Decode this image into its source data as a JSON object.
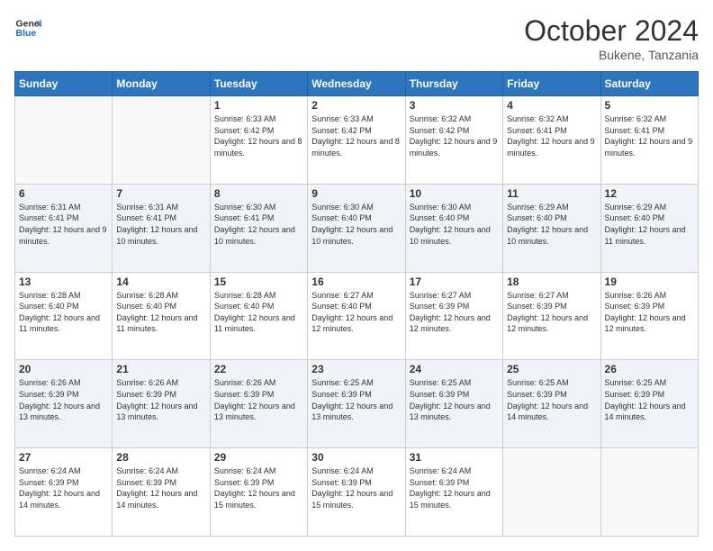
{
  "header": {
    "logo_line1": "General",
    "logo_line2": "Blue",
    "month": "October 2024",
    "location": "Bukene, Tanzania"
  },
  "days_of_week": [
    "Sunday",
    "Monday",
    "Tuesday",
    "Wednesday",
    "Thursday",
    "Friday",
    "Saturday"
  ],
  "weeks": [
    [
      {
        "day": "",
        "detail": ""
      },
      {
        "day": "",
        "detail": ""
      },
      {
        "day": "1",
        "detail": "Sunrise: 6:33 AM\nSunset: 6:42 PM\nDaylight: 12 hours and 8 minutes."
      },
      {
        "day": "2",
        "detail": "Sunrise: 6:33 AM\nSunset: 6:42 PM\nDaylight: 12 hours and 8 minutes."
      },
      {
        "day": "3",
        "detail": "Sunrise: 6:32 AM\nSunset: 6:42 PM\nDaylight: 12 hours and 9 minutes."
      },
      {
        "day": "4",
        "detail": "Sunrise: 6:32 AM\nSunset: 6:41 PM\nDaylight: 12 hours and 9 minutes."
      },
      {
        "day": "5",
        "detail": "Sunrise: 6:32 AM\nSunset: 6:41 PM\nDaylight: 12 hours and 9 minutes."
      }
    ],
    [
      {
        "day": "6",
        "detail": "Sunrise: 6:31 AM\nSunset: 6:41 PM\nDaylight: 12 hours and 9 minutes."
      },
      {
        "day": "7",
        "detail": "Sunrise: 6:31 AM\nSunset: 6:41 PM\nDaylight: 12 hours and 10 minutes."
      },
      {
        "day": "8",
        "detail": "Sunrise: 6:30 AM\nSunset: 6:41 PM\nDaylight: 12 hours and 10 minutes."
      },
      {
        "day": "9",
        "detail": "Sunrise: 6:30 AM\nSunset: 6:40 PM\nDaylight: 12 hours and 10 minutes."
      },
      {
        "day": "10",
        "detail": "Sunrise: 6:30 AM\nSunset: 6:40 PM\nDaylight: 12 hours and 10 minutes."
      },
      {
        "day": "11",
        "detail": "Sunrise: 6:29 AM\nSunset: 6:40 PM\nDaylight: 12 hours and 10 minutes."
      },
      {
        "day": "12",
        "detail": "Sunrise: 6:29 AM\nSunset: 6:40 PM\nDaylight: 12 hours and 11 minutes."
      }
    ],
    [
      {
        "day": "13",
        "detail": "Sunrise: 6:28 AM\nSunset: 6:40 PM\nDaylight: 12 hours and 11 minutes."
      },
      {
        "day": "14",
        "detail": "Sunrise: 6:28 AM\nSunset: 6:40 PM\nDaylight: 12 hours and 11 minutes."
      },
      {
        "day": "15",
        "detail": "Sunrise: 6:28 AM\nSunset: 6:40 PM\nDaylight: 12 hours and 11 minutes."
      },
      {
        "day": "16",
        "detail": "Sunrise: 6:27 AM\nSunset: 6:40 PM\nDaylight: 12 hours and 12 minutes."
      },
      {
        "day": "17",
        "detail": "Sunrise: 6:27 AM\nSunset: 6:39 PM\nDaylight: 12 hours and 12 minutes."
      },
      {
        "day": "18",
        "detail": "Sunrise: 6:27 AM\nSunset: 6:39 PM\nDaylight: 12 hours and 12 minutes."
      },
      {
        "day": "19",
        "detail": "Sunrise: 6:26 AM\nSunset: 6:39 PM\nDaylight: 12 hours and 12 minutes."
      }
    ],
    [
      {
        "day": "20",
        "detail": "Sunrise: 6:26 AM\nSunset: 6:39 PM\nDaylight: 12 hours and 13 minutes."
      },
      {
        "day": "21",
        "detail": "Sunrise: 6:26 AM\nSunset: 6:39 PM\nDaylight: 12 hours and 13 minutes."
      },
      {
        "day": "22",
        "detail": "Sunrise: 6:26 AM\nSunset: 6:39 PM\nDaylight: 12 hours and 13 minutes."
      },
      {
        "day": "23",
        "detail": "Sunrise: 6:25 AM\nSunset: 6:39 PM\nDaylight: 12 hours and 13 minutes."
      },
      {
        "day": "24",
        "detail": "Sunrise: 6:25 AM\nSunset: 6:39 PM\nDaylight: 12 hours and 13 minutes."
      },
      {
        "day": "25",
        "detail": "Sunrise: 6:25 AM\nSunset: 6:39 PM\nDaylight: 12 hours and 14 minutes."
      },
      {
        "day": "26",
        "detail": "Sunrise: 6:25 AM\nSunset: 6:39 PM\nDaylight: 12 hours and 14 minutes."
      }
    ],
    [
      {
        "day": "27",
        "detail": "Sunrise: 6:24 AM\nSunset: 6:39 PM\nDaylight: 12 hours and 14 minutes."
      },
      {
        "day": "28",
        "detail": "Sunrise: 6:24 AM\nSunset: 6:39 PM\nDaylight: 12 hours and 14 minutes."
      },
      {
        "day": "29",
        "detail": "Sunrise: 6:24 AM\nSunset: 6:39 PM\nDaylight: 12 hours and 15 minutes."
      },
      {
        "day": "30",
        "detail": "Sunrise: 6:24 AM\nSunset: 6:39 PM\nDaylight: 12 hours and 15 minutes."
      },
      {
        "day": "31",
        "detail": "Sunrise: 6:24 AM\nSunset: 6:39 PM\nDaylight: 12 hours and 15 minutes."
      },
      {
        "day": "",
        "detail": ""
      },
      {
        "day": "",
        "detail": ""
      }
    ]
  ]
}
